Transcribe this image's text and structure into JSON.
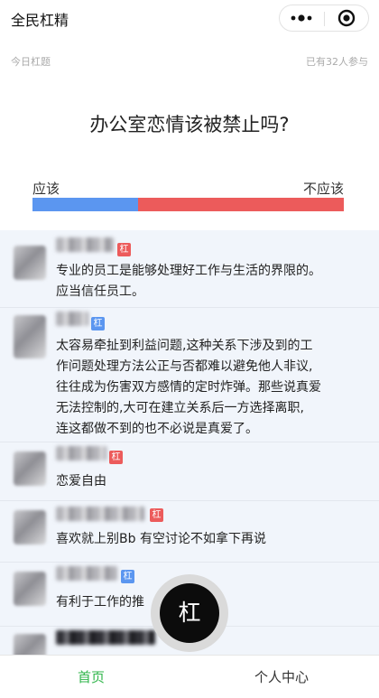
{
  "nav": {
    "title": "全民杠精"
  },
  "topic": {
    "label": "今日杠题",
    "participants": "已有32人参与"
  },
  "question": "办公室恋情该被禁止吗?",
  "vote": {
    "yes_label": "应该",
    "no_label": "不应该",
    "yes_fraction": 0.34
  },
  "comments": [
    {
      "badge": "杠",
      "badge_color": "#ec5b5b",
      "lines": [
        "专业的员工是能够处理好工作与生活的界限的。",
        "应当信任员工。"
      ]
    },
    {
      "badge": "杠",
      "badge_color": "#5b96f0",
      "lines": [
        "太容易牵扯到利益问题,这种关系下涉及到的工",
        "作问题处理方法公正与否都难以避免他人非议,",
        "往往成为伤害双方感情的定时炸弹。那些说真爱",
        "无法控制的,大可在建立关系后一方选择离职,",
        "连这都做不到的也不必说是真爱了。"
      ]
    },
    {
      "badge": "杠",
      "badge_color": "#ec5b5b",
      "lines": [
        "恋爱自由"
      ]
    },
    {
      "badge": "杠",
      "badge_color": "#ec5b5b",
      "lines": [
        "喜欢就上别Bb 有空讨论不如拿下再说"
      ]
    },
    {
      "badge": "杠",
      "badge_color": "#5b96f0",
      "lines": [
        "有利于工作的推"
      ]
    }
  ],
  "fab": {
    "label": "杠"
  },
  "tabs": {
    "home": "首页",
    "profile": "个人中心"
  }
}
